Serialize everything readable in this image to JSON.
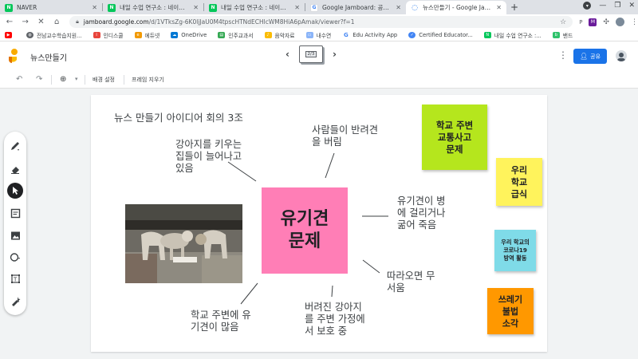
{
  "browser": {
    "tabs": [
      {
        "title": "NAVER",
        "favicon": "N",
        "favicon_color": "#03c75a"
      },
      {
        "title": "내일 수업 연구소 : 네이버 블로그",
        "favicon": "N",
        "favicon_color": "#03c75a"
      },
      {
        "title": "내일 수업 연구소 : 네이버 블로그",
        "favicon": "N",
        "favicon_color": "#03c75a"
      },
      {
        "title": "Google Jamboard: 공동작업 디지털",
        "favicon": "G",
        "favicon_color": "#4285f4"
      },
      {
        "title": "뉴스만들기 - Google Jamboard",
        "favicon": "◌",
        "favicon_color": "#1a73e8",
        "active": true
      }
    ],
    "url_host": "jamboard.google.com",
    "url_path": "/d/1VTksZg-6K0ljJaU0M4tpscHTNdECHlcWM8HiA6pAmak/viewer?f=1",
    "bookmarks": [
      {
        "label": "",
        "color": "#ff0000",
        "icon": "youtube-icon"
      },
      {
        "label": "전남교수학습지원...",
        "color": "#5f6368"
      },
      {
        "label": "인디스쿨",
        "color": "#e8453c"
      },
      {
        "label": "에듀넷",
        "color": "#f29900"
      },
      {
        "label": "OneDrive",
        "color": "#0078d4"
      },
      {
        "label": "인주교과서",
        "color": "#34a853"
      },
      {
        "label": "음악자료",
        "color": "#fbbc04"
      },
      {
        "label": "내수연",
        "color": "#8ab4f8"
      },
      {
        "label": "Edu Activity App",
        "color": "#4285f4"
      },
      {
        "label": "Certified Educator...",
        "color": "#4285f4"
      },
      {
        "label": "내일 수업 연구소 :...",
        "color": "#03c75a"
      },
      {
        "label": "밴드",
        "color": "#2ec26a"
      }
    ]
  },
  "app": {
    "doc_title": "뉴스만들기",
    "frame_counter": "2/3",
    "share_label": "공유",
    "toolbar": {
      "background_label": "배경 설정",
      "clear_frame_label": "프레임 지우기"
    }
  },
  "board": {
    "heading": "뉴스 만들기 아이디어 회의 3조",
    "center_note": "유기견\n문제",
    "ideas": {
      "top_left": "강아지를 키우는\n집들이 늘어나고\n있음",
      "top": "사람들이 반려견\n을 버림",
      "right": "유기견이 병\n에 걸리거나\n굶어 죽음",
      "bottom_right": "따라오면 무\n서움",
      "bottom": "버려진 강아지\n를 주변 가정에\n서 보호 중",
      "bottom_left": "학교 주변에 유\n기견이 많음"
    },
    "stickies": [
      {
        "text": "학교 주변\n교통사고\n문제",
        "color": "#b5e61d"
      },
      {
        "text": "우리\n학교\n급식",
        "color": "#fff35c"
      },
      {
        "text": "우리 학교의\n코로나19\n방역 활동",
        "color": "#7fdbe8"
      },
      {
        "text": "쓰레기\n불법\n소각",
        "color": "#ff9800"
      }
    ]
  }
}
